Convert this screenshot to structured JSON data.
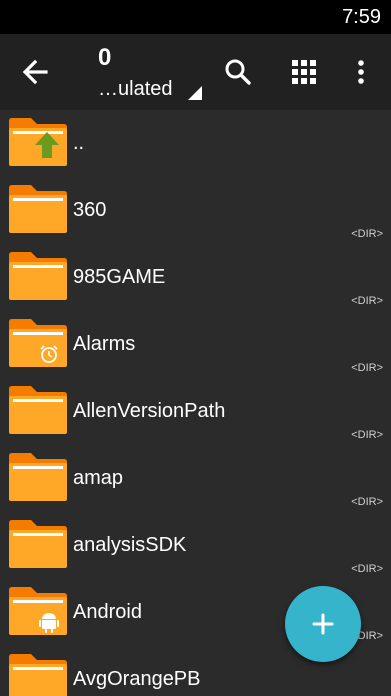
{
  "status": {
    "time": "7:59"
  },
  "toolbar": {
    "count": "0",
    "path": "…ulated",
    "back_icon": "arrow-back-icon",
    "search_icon": "search-icon",
    "grid_icon": "grid-view-icon",
    "more_icon": "more-vert-icon"
  },
  "list": {
    "parent": {
      "name": ".."
    },
    "items": [
      {
        "name": "360",
        "tag": "<DIR>",
        "badge": "none"
      },
      {
        "name": "985GAME",
        "tag": "<DIR>",
        "badge": "none"
      },
      {
        "name": "Alarms",
        "tag": "<DIR>",
        "badge": "alarm-clock-icon"
      },
      {
        "name": "AllenVersionPath",
        "tag": "<DIR>",
        "badge": "none"
      },
      {
        "name": "amap",
        "tag": "<DIR>",
        "badge": "none"
      },
      {
        "name": "analysisSDK",
        "tag": "<DIR>",
        "badge": "none"
      },
      {
        "name": "Android",
        "tag": "<DIR>",
        "badge": "android-icon"
      },
      {
        "name": "AvgOrangePB",
        "tag": "",
        "badge": "none"
      }
    ]
  },
  "fab": {
    "icon": "plus-icon"
  },
  "colors": {
    "folder_body": "#ffa726",
    "folder_tab": "#f57c00",
    "accent": "#36b4cb",
    "up_arrow": "#6b9a1f"
  }
}
